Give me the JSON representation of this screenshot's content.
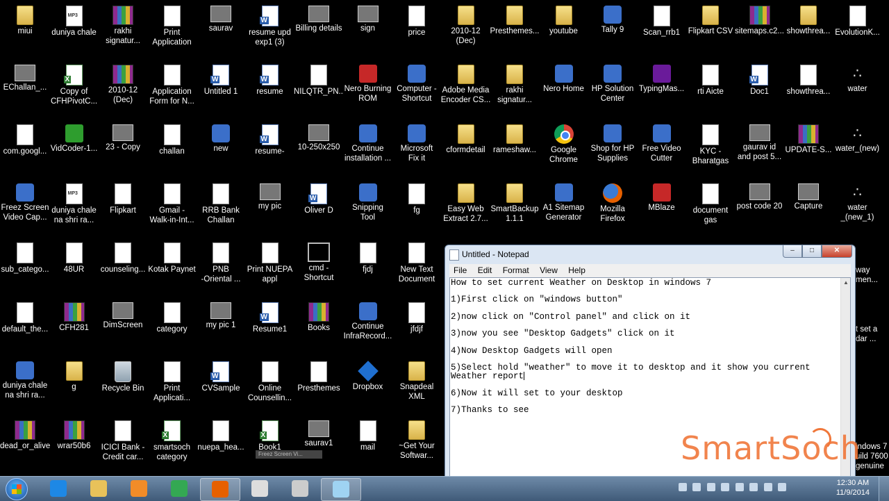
{
  "desktop": {
    "icons": [
      {
        "label": "miui",
        "type": "folder"
      },
      {
        "label": "duniya chale",
        "type": "mp3"
      },
      {
        "label": "rakhi\nsignatur...",
        "type": "rar"
      },
      {
        "label": "Print\nApplication",
        "type": "doc"
      },
      {
        "label": "saurav",
        "type": "img"
      },
      {
        "label": "resume upd\nexp1 (3)",
        "type": "word"
      },
      {
        "label": "Billing details",
        "type": "img"
      },
      {
        "label": "sign",
        "type": "img"
      },
      {
        "label": "price",
        "type": "doc"
      },
      {
        "label": "2010-12\n(Dec)",
        "type": "folder"
      },
      {
        "label": "Presthemes...",
        "type": "folder"
      },
      {
        "label": "youtube",
        "type": "folder"
      },
      {
        "label": "Tally 9",
        "type": "app"
      },
      {
        "label": "Scan_rrb1",
        "type": "doc"
      },
      {
        "label": "Flipkart CSV",
        "type": "folder"
      },
      {
        "label": "sitemaps.c2...",
        "type": "rar"
      },
      {
        "label": "showthrea...",
        "type": "folder"
      },
      {
        "label": "EvolutionK...",
        "type": "doc"
      },
      {
        "label": "EChallan_...",
        "type": "img"
      },
      {
        "label": "Copy of\nCFHPivotC...",
        "type": "excel"
      },
      {
        "label": "2010-12\n(Dec)",
        "type": "rar"
      },
      {
        "label": "Application\nForm for N...",
        "type": "doc"
      },
      {
        "label": "Untitled 1",
        "type": "word"
      },
      {
        "label": "resume",
        "type": "word"
      },
      {
        "label": "NILQTR_PN...",
        "type": "doc"
      },
      {
        "label": "Nero Burning\nROM",
        "type": "red"
      },
      {
        "label": "Computer -\nShortcut",
        "type": "app"
      },
      {
        "label": "Adobe Media\nEncoder CS...",
        "type": "folder"
      },
      {
        "label": "rakhi\nsignatur...",
        "type": "folder"
      },
      {
        "label": "Nero Home",
        "type": "app"
      },
      {
        "label": "HP Solution\nCenter",
        "type": "app"
      },
      {
        "label": "TypingMas...",
        "type": "purple"
      },
      {
        "label": "rti Aicte",
        "type": "doc"
      },
      {
        "label": "Doc1",
        "type": "word"
      },
      {
        "label": "showthrea...",
        "type": "doc"
      },
      {
        "label": "water",
        "type": "water"
      },
      {
        "label": "com.googl...",
        "type": "doc"
      },
      {
        "label": "VidCoder-1...",
        "type": "green"
      },
      {
        "label": "23 - Copy",
        "type": "img"
      },
      {
        "label": "challan",
        "type": "doc"
      },
      {
        "label": "new",
        "type": "app"
      },
      {
        "label": "resume-",
        "type": "word"
      },
      {
        "label": "10-250x250",
        "type": "img"
      },
      {
        "label": "Continue\ninstallation ...",
        "type": "app"
      },
      {
        "label": "Microsoft\nFix it",
        "type": "app"
      },
      {
        "label": "cformdetail",
        "type": "folder"
      },
      {
        "label": "rameshaw...",
        "type": "folder"
      },
      {
        "label": "Google\nChrome",
        "type": "chrome"
      },
      {
        "label": "Shop for HP\nSupplies",
        "type": "app"
      },
      {
        "label": "Free Video\nCutter",
        "type": "app"
      },
      {
        "label": "KYC -\nBharatgas",
        "type": "doc"
      },
      {
        "label": "gaurav id\nand post 5...",
        "type": "img"
      },
      {
        "label": "UPDATE-S...",
        "type": "rar"
      },
      {
        "label": "water_(new)",
        "type": "water"
      },
      {
        "label": "Freez Screen\nVideo Cap...",
        "type": "app"
      },
      {
        "label": "duniya chale\nna shri ra...",
        "type": "mp3"
      },
      {
        "label": "Flipkart",
        "type": "doc"
      },
      {
        "label": "Gmail -\nWalk-in-Int...",
        "type": "doc"
      },
      {
        "label": "RRB Bank\nChallan",
        "type": "doc"
      },
      {
        "label": "my pic",
        "type": "img"
      },
      {
        "label": "Oliver D",
        "type": "word"
      },
      {
        "label": "Snipping\nTool",
        "type": "app"
      },
      {
        "label": "fg",
        "type": "doc"
      },
      {
        "label": "Easy Web\nExtract 2.7...",
        "type": "folder"
      },
      {
        "label": "SmartBackup\n1.1.1",
        "type": "folder"
      },
      {
        "label": "A1 Sitemap\nGenerator",
        "type": "app"
      },
      {
        "label": "Mozilla\nFirefox",
        "type": "firefox"
      },
      {
        "label": "MBlaze",
        "type": "red"
      },
      {
        "label": "document\ngas",
        "type": "doc"
      },
      {
        "label": "post code 20",
        "type": "img"
      },
      {
        "label": "Capture",
        "type": "img"
      },
      {
        "label": "water\n_(new_1)",
        "type": "water"
      },
      {
        "label": "sub_catego...",
        "type": "doc"
      },
      {
        "label": "48UR",
        "type": "doc"
      },
      {
        "label": "counseling...",
        "type": "doc"
      },
      {
        "label": "Kotak Paynet",
        "type": "doc"
      },
      {
        "label": "PNB\n-Oriental ...",
        "type": "doc"
      },
      {
        "label": "Print NUEPA\nappl",
        "type": "doc"
      },
      {
        "label": "cmd -\nShortcut",
        "type": "cmd"
      },
      {
        "label": "fjdj",
        "type": "doc"
      },
      {
        "label": "New Text\nDocument",
        "type": "doc"
      },
      {
        "label": "default_the...",
        "type": "doc"
      },
      {
        "label": "CFH281",
        "type": "rar"
      },
      {
        "label": "DimScreen",
        "type": "img"
      },
      {
        "label": "category",
        "type": "doc"
      },
      {
        "label": "my pic 1",
        "type": "img"
      },
      {
        "label": "Resume1",
        "type": "word"
      },
      {
        "label": "Books",
        "type": "rar"
      },
      {
        "label": "Continue\nInfraRecord...",
        "type": "app"
      },
      {
        "label": "jfdjf",
        "type": "doc"
      },
      {
        "label": "duniya chale\nna shri ra...",
        "type": "app"
      },
      {
        "label": "g",
        "type": "folder"
      },
      {
        "label": "Recycle Bin",
        "type": "recycle"
      },
      {
        "label": "Print\nApplicati...",
        "type": "doc"
      },
      {
        "label": "CVSample",
        "type": "word"
      },
      {
        "label": "Online\nCounsellin...",
        "type": "doc"
      },
      {
        "label": "Presthemes",
        "type": "doc"
      },
      {
        "label": "Dropbox",
        "type": "dropbox"
      },
      {
        "label": "Snapdeal\nXML",
        "type": "folder"
      },
      {
        "label": "dead_or_alive",
        "type": "rar"
      },
      {
        "label": "wrar50b6",
        "type": "rar"
      },
      {
        "label": "ICICI Bank -\nCredit car...",
        "type": "doc"
      },
      {
        "label": "smartsoch\ncategory",
        "type": "excel"
      },
      {
        "label": "nuepa_hea...",
        "type": "doc"
      },
      {
        "label": "Book1",
        "type": "excel"
      },
      {
        "label": "saurav1",
        "type": "img"
      },
      {
        "label": "mail",
        "type": "doc"
      },
      {
        "label": "~Get Your\nSoftwar...",
        "type": "folder"
      }
    ],
    "side_fragments": {
      "way": "way\nmen...",
      "setgadget": "t set a\ndar ...",
      "win7": "indows 7\nuild 7600\ngenuine"
    },
    "tooltip": "Freez Screen Vi..."
  },
  "notepad": {
    "title": "Untitled - Notepad",
    "buttons": {
      "minimize": "–",
      "maximize": "□",
      "close": "✕"
    },
    "menu": [
      "File",
      "Edit",
      "Format",
      "View",
      "Help"
    ],
    "content": "How to set current Weather on Desktop in windows 7\n\n1)First click on \"windows button\"\n\n2)now click on \"Control panel\" and click on it\n\n3)now you see \"Desktop Gadgets\" click on it\n\n4)Now Desktop Gadgets will open\n\n5)Select hold \"weather\" to move it to desktop and it show you current\nWeather report",
    "content_after_caret": "\n\n6)Now it will set to your desktop\n\n7)Thanks to see"
  },
  "taskbar": {
    "pinned": [
      {
        "name": "internet-explorer",
        "color": "#1e88e5"
      },
      {
        "name": "windows-explorer",
        "color": "#e8c25a"
      },
      {
        "name": "media-player",
        "color": "#f28c28"
      },
      {
        "name": "google-chrome",
        "color": "#34a853"
      },
      {
        "name": "firefox",
        "color": "#e66000"
      },
      {
        "name": "blank-window",
        "color": "#dddddd"
      },
      {
        "name": "camera",
        "color": "#cccccc"
      },
      {
        "name": "notepad",
        "color": "#9fd3f2"
      }
    ],
    "clock": {
      "time": "12:30 AM",
      "date": "11/9/2014"
    }
  },
  "watermark": "SmartSoch",
  "colors": {
    "accent": "#f0773a",
    "taskbar": "#4f6b8a"
  }
}
